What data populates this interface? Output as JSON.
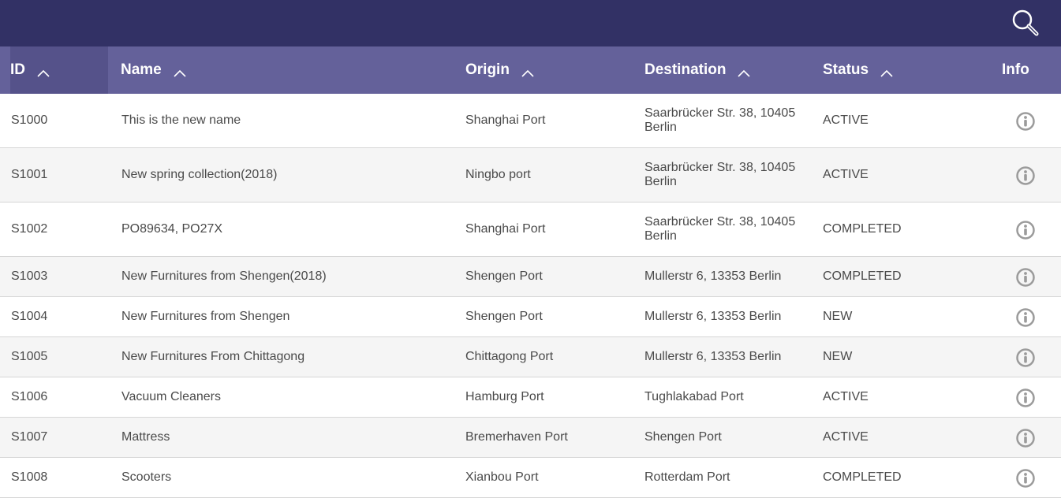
{
  "header": {
    "columns": {
      "id": "ID",
      "name": "Name",
      "origin": "Origin",
      "destination": "Destination",
      "status": "Status",
      "info": "Info"
    }
  },
  "rows": [
    {
      "id": "S1000",
      "name": "This is the new name",
      "origin": "Shanghai Port",
      "destination": "Saarbrücker Str. 38, 10405 Berlin",
      "status": "ACTIVE"
    },
    {
      "id": "S1001",
      "name": "New spring collection(2018)",
      "origin": "Ningbo port",
      "destination": "Saarbrücker Str. 38, 10405 Berlin",
      "status": "ACTIVE"
    },
    {
      "id": "S1002",
      "name": "PO89634, PO27X",
      "origin": "Shanghai Port",
      "destination": "Saarbrücker Str. 38, 10405 Berlin",
      "status": "COMPLETED"
    },
    {
      "id": "S1003",
      "name": "New Furnitures from Shengen(2018)",
      "origin": "Shengen Port",
      "destination": "Mullerstr 6, 13353 Berlin",
      "status": "COMPLETED"
    },
    {
      "id": "S1004",
      "name": "New Furnitures from Shengen",
      "origin": "Shengen Port",
      "destination": "Mullerstr 6, 13353 Berlin",
      "status": "NEW"
    },
    {
      "id": "S1005",
      "name": "New Furnitures From Chittagong",
      "origin": "Chittagong Port",
      "destination": "Mullerstr 6, 13353 Berlin",
      "status": "NEW"
    },
    {
      "id": "S1006",
      "name": "Vacuum Cleaners",
      "origin": "Hamburg Port",
      "destination": "Tughlakabad Port",
      "status": "ACTIVE"
    },
    {
      "id": "S1007",
      "name": "Mattress",
      "origin": "Bremerhaven Port",
      "destination": "Shengen Port",
      "status": "ACTIVE"
    },
    {
      "id": "S1008",
      "name": "Scooters",
      "origin": "Xianbou Port",
      "destination": "Rotterdam Port",
      "status": "COMPLETED"
    }
  ],
  "icons": {
    "search": "search-icon",
    "sort": "chevron-up-icon",
    "info": "info-icon"
  },
  "colors": {
    "topbar": "#323165",
    "header": "#64619a",
    "header_active": "#55528a",
    "info_icon": "#9b9b9b"
  }
}
